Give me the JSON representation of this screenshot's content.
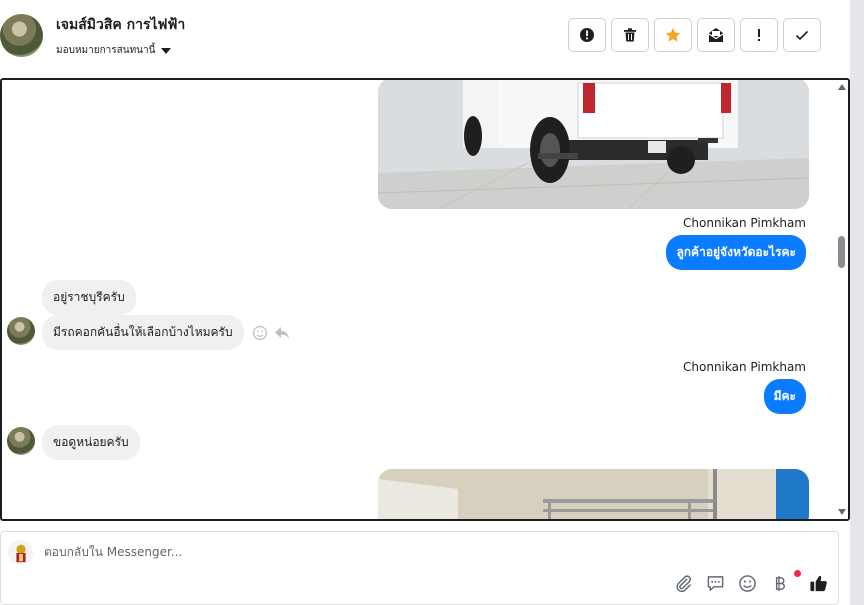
{
  "header": {
    "contact_name": "เจมส์มิวสิค การไฟฟ้า",
    "assign_label": "มอบหมายการสนทนานี้",
    "toolbar": [
      {
        "icon": "alert-circle-icon",
        "name": "alert-button"
      },
      {
        "icon": "trash-icon",
        "name": "delete-button"
      },
      {
        "icon": "star-icon",
        "name": "star-button"
      },
      {
        "icon": "mark-unread-icon",
        "name": "mark-unread-button"
      },
      {
        "icon": "exclamation-icon",
        "name": "mark-spam-button"
      },
      {
        "icon": "check-icon",
        "name": "mark-done-button"
      }
    ]
  },
  "messages": {
    "sender_1": "Chonnikan Pimkham",
    "out_1": "ลูกค้าอยู่จังหวัดอะไรคะ",
    "in_1": "อยู่ราชบุรีครับ",
    "in_2": "มีรถคอกคันอื่นให้เลือกบ้างไหมครับ",
    "sender_2": "Chonnikan Pimkham",
    "out_2": "มีคะ",
    "in_3": "ขอดูหน่อยครับ"
  },
  "composer": {
    "placeholder": "ตอบกลับใน Messenger..."
  },
  "colors": {
    "accent": "#0a7cff",
    "star": "#f5a623",
    "notification": "#f02849"
  }
}
